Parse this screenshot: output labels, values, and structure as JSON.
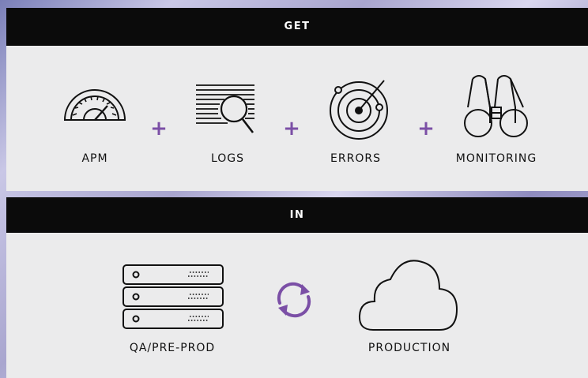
{
  "get_section": {
    "header": "GET",
    "items": [
      {
        "label": "APM",
        "icon": "speedometer-icon"
      },
      {
        "label": "LOGS",
        "icon": "log-search-icon"
      },
      {
        "label": "ERRORS",
        "icon": "radar-icon"
      },
      {
        "label": "MONITORING",
        "icon": "binoculars-icon"
      }
    ],
    "plus": [
      "+",
      "+",
      "+"
    ]
  },
  "in_section": {
    "header": "IN",
    "items": [
      {
        "label": "QA/PRE-PROD",
        "icon": "server-stack-icon"
      },
      {
        "label": "PRODUCTION",
        "icon": "cloud-icon"
      }
    ],
    "sync_icon": "sync-icon"
  },
  "colors": {
    "accent": "#7b4fa6",
    "header_bg": "#0b0b0b",
    "panel_bg": "#ebebec",
    "line": "#111111"
  }
}
